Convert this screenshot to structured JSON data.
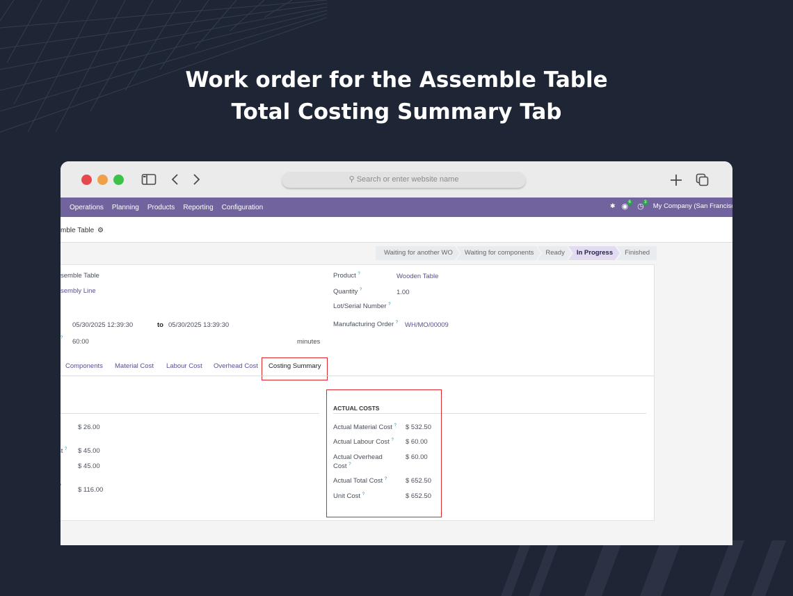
{
  "headline": {
    "line1": "Work order for the Assemble Table",
    "line2": "Total Costing Summary Tab"
  },
  "browser": {
    "address_placeholder": "Search or enter website name"
  },
  "navbar": {
    "menu": [
      "Operations",
      "Planning",
      "Products",
      "Reporting",
      "Configuration"
    ],
    "messages_count": "6",
    "activities_count": "3",
    "company": "My Company (San Francisco)"
  },
  "breadcrumb": {
    "title": "mble Table"
  },
  "status_stages": [
    "Waiting for another WO",
    "Waiting for components",
    "Ready",
    "In Progress",
    "Finished"
  ],
  "active_stage": "In Progress",
  "form": {
    "left": {
      "name_value": "semble Table",
      "workcenter_value": "sembly Line",
      "date_start": "05/30/2025 12:39:30",
      "date_to_label": "to",
      "date_end": "05/30/2025 13:39:30",
      "duration_value": "60:00",
      "duration_unit": "minutes"
    },
    "right": {
      "product_label": "Product",
      "product_value": "Wooden Table",
      "quantity_label": "Quantity",
      "quantity_value": "1.00",
      "lot_label": "Lot/Serial Number",
      "mo_label": "Manufacturing Order",
      "mo_value": "WH/MO/00009"
    }
  },
  "tabs": [
    "Components",
    "Material Cost",
    "Labour Cost",
    "Overhead Cost",
    "Costing Summary"
  ],
  "costing": {
    "planned_values": [
      "$ 26.00",
      "$ 45.00",
      "$ 45.00",
      "$ 116.00"
    ],
    "planned_partial_label": "st",
    "actual_title": "ACTUAL COSTS",
    "actual": [
      {
        "label": "Actual Material Cost",
        "value": "$ 532.50"
      },
      {
        "label": "Actual Labour Cost",
        "value": "$ 60.00"
      },
      {
        "label": "Actual Overhead",
        "label2": "Cost",
        "value": "$ 60.00"
      },
      {
        "label": "Actual Total Cost",
        "value": "$ 652.50"
      },
      {
        "label": "Unit Cost",
        "value": "$ 652.50"
      }
    ]
  },
  "colors": {
    "background": "#1e2535",
    "navbar": "#71639e",
    "highlight": "#e0262c",
    "link": "#5b4f8f"
  }
}
